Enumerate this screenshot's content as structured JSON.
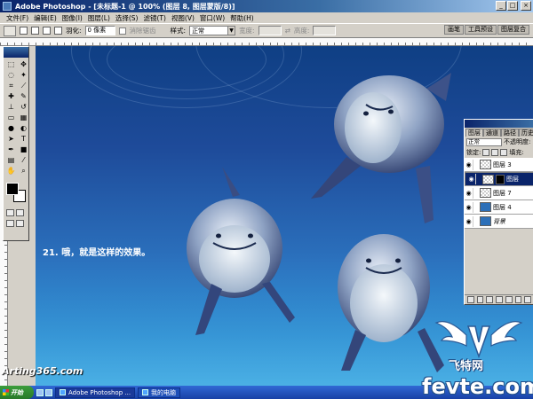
{
  "window": {
    "title": "Adobe Photoshop - [未标题-1 @ 100% (图层 8, 图层蒙版/8)]"
  },
  "menu": [
    "文件(F)",
    "编辑(E)",
    "图像(I)",
    "图层(L)",
    "选择(S)",
    "滤镜(T)",
    "视图(V)",
    "窗口(W)",
    "帮助(H)"
  ],
  "options": {
    "feather_label": "羽化:",
    "feather_value": "0 像素",
    "antialias_label": "消除锯齿",
    "style_label": "样式:",
    "style_value": "正常",
    "width_label": "宽度:",
    "height_label": "高度:"
  },
  "palette_well": {
    "tabs": [
      "画笔",
      "工具预设",
      "图层复合"
    ]
  },
  "canvas": {
    "caption": "21. 哦，就是这样的效果。"
  },
  "layers_panel": {
    "tabs": [
      "图层",
      "通道",
      "路径",
      "历史记录"
    ],
    "blend_mode": "正常",
    "opacity_label": "不透明度:",
    "lock_label": "锁定:",
    "fill_label": "填充:",
    "layers": [
      {
        "name": "图层 3",
        "selected": false,
        "thumb": "checker",
        "mask": false
      },
      {
        "name": "图层",
        "selected": true,
        "thumb": "checker",
        "mask": true
      },
      {
        "name": "图层 7",
        "selected": false,
        "thumb": "checker",
        "mask": false
      },
      {
        "name": "图层 4",
        "selected": false,
        "thumb": "blue",
        "mask": false
      },
      {
        "name": "背景",
        "selected": false,
        "thumb": "blue",
        "mask": false
      }
    ]
  },
  "taskbar": {
    "start_label": "开始",
    "items": [
      "Adobe Photoshop ...",
      "我的电脑"
    ]
  },
  "watermarks": {
    "arting": "Arting365.com",
    "site_cn": "飞特网",
    "site_en": "fevte.com"
  }
}
